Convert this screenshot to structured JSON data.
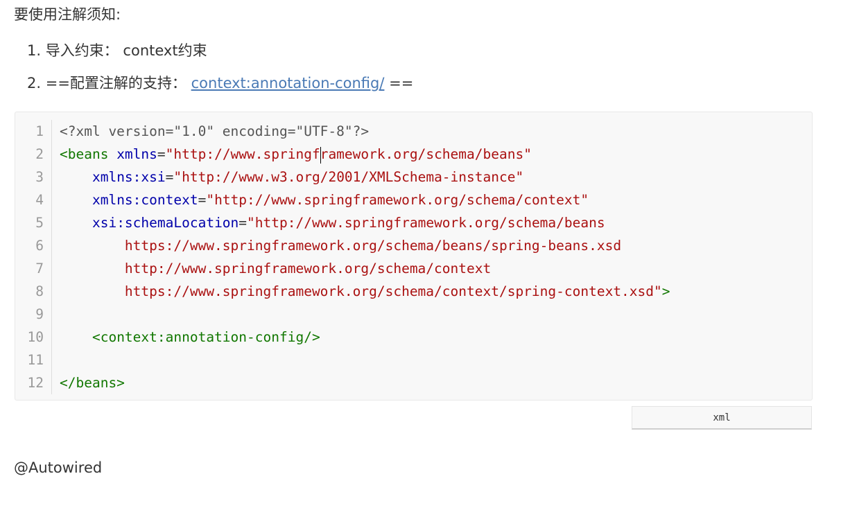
{
  "heading": "要使用注解须知:",
  "list": [
    {
      "number": "1.",
      "label": "导入约束：",
      "value": "context约束"
    },
    {
      "number": "2.",
      "prefix": "==配置注解的支持：",
      "link": "context:annotation-config/",
      "suffix": "=="
    }
  ],
  "code": {
    "language": "xml",
    "lines": [
      {
        "n": "1",
        "tokens": [
          {
            "c": "t-gray",
            "t": "<?xml version=\"1.0\" encoding=\"UTF-8\"?>"
          }
        ]
      },
      {
        "n": "2",
        "tokens": [
          {
            "c": "t-tag",
            "t": "<beans "
          },
          {
            "c": "t-attr",
            "t": "xmlns"
          },
          {
            "c": "t-plain",
            "t": "="
          },
          {
            "c": "t-str",
            "t": "\"http://www.springf"
          },
          {
            "c": "cursor",
            "t": ""
          },
          {
            "c": "t-str",
            "t": "ramework.org/schema/beans\""
          }
        ]
      },
      {
        "n": "3",
        "tokens": [
          {
            "c": "t-plain",
            "t": "    "
          },
          {
            "c": "t-attr",
            "t": "xmlns:xsi"
          },
          {
            "c": "t-plain",
            "t": "="
          },
          {
            "c": "t-str",
            "t": "\"http://www.w3.org/2001/XMLSchema-instance\""
          }
        ]
      },
      {
        "n": "4",
        "tokens": [
          {
            "c": "t-plain",
            "t": "    "
          },
          {
            "c": "t-attr",
            "t": "xmlns:context"
          },
          {
            "c": "t-plain",
            "t": "="
          },
          {
            "c": "t-str",
            "t": "\"http://www.springframework.org/schema/context\""
          }
        ]
      },
      {
        "n": "5",
        "tokens": [
          {
            "c": "t-plain",
            "t": "    "
          },
          {
            "c": "t-attr",
            "t": "xsi:schemaLocation"
          },
          {
            "c": "t-plain",
            "t": "="
          },
          {
            "c": "t-str",
            "t": "\"http://www.springframework.org/schema/beans"
          }
        ]
      },
      {
        "n": "6",
        "tokens": [
          {
            "c": "t-str",
            "t": "        https://www.springframework.org/schema/beans/spring-beans.xsd"
          }
        ]
      },
      {
        "n": "7",
        "tokens": [
          {
            "c": "t-str",
            "t": "        http://www.springframework.org/schema/context"
          }
        ]
      },
      {
        "n": "8",
        "tokens": [
          {
            "c": "t-str",
            "t": "        https://www.springframework.org/schema/context/spring-context.xsd\""
          },
          {
            "c": "t-tag",
            "t": ">"
          }
        ]
      },
      {
        "n": "9",
        "tokens": []
      },
      {
        "n": "10",
        "tokens": [
          {
            "c": "t-plain",
            "t": "    "
          },
          {
            "c": "t-tag",
            "t": "<context:annotation-config/>"
          }
        ]
      },
      {
        "n": "11",
        "tokens": []
      },
      {
        "n": "12",
        "tokens": [
          {
            "c": "t-tag",
            "t": "</beans>"
          }
        ]
      }
    ]
  },
  "footer_text": "@Autowired",
  "colors": {
    "link": "#4a7ab5",
    "tag": "#117700",
    "attribute": "#0000aa",
    "string": "#aa1111",
    "prolog": "#555555",
    "line_number": "#999999",
    "code_background": "#f8f8f8"
  }
}
